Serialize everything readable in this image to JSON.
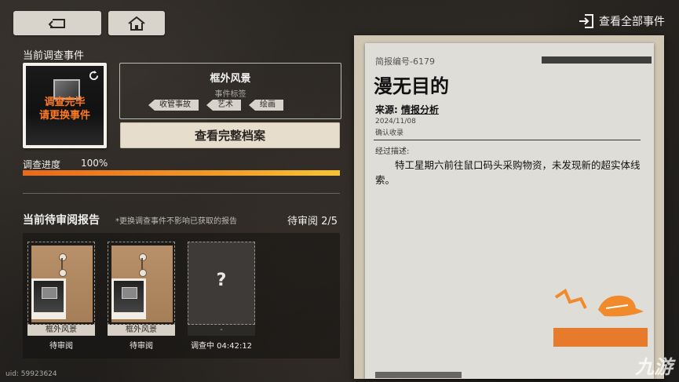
{
  "header": {
    "back_icon": "return-arrow-icon",
    "home_icon": "home-icon",
    "view_all_label": "查看全部事件",
    "view_all_icon": "exit-door-icon"
  },
  "current_event": {
    "section_title": "当前调查事件",
    "card_status_line1": "调查完毕",
    "card_status_line2": "请更换事件",
    "name": "框外风景",
    "tag_label": "事件标签",
    "tags": [
      "收管事故",
      "艺术",
      "绘画"
    ],
    "archive_button": "查看完整档案",
    "progress_label": "调查进度",
    "progress_value": "100%",
    "progress_fraction": 1.0
  },
  "review": {
    "section_title": "当前待审阅报告",
    "note": "*更换调查事件不影响已获取的报告",
    "count": "待审阅 2/5",
    "reports": [
      {
        "caption": "框外风景",
        "status": "待审阅"
      },
      {
        "caption": "框外风景",
        "status": "待审阅"
      },
      {
        "caption": "-",
        "status": "调查中 04:42:12",
        "mystery": "?"
      }
    ]
  },
  "uid": "uid: 59923624",
  "document": {
    "number": "简报编号-6179",
    "title": "漫无目的",
    "source_label": "来源:",
    "source_value": "情报分析",
    "date": "2024/11/08",
    "confirm": "确认收录",
    "desc_label": "经过描述:",
    "body": "特工星期六前往鼠口码头采购物资，未发现新的超实体线索。"
  },
  "watermark": "九游",
  "colors": {
    "accent_orange": "#f09a2a",
    "alert_orange": "#ff7a26",
    "paper": "#dfddd8"
  }
}
